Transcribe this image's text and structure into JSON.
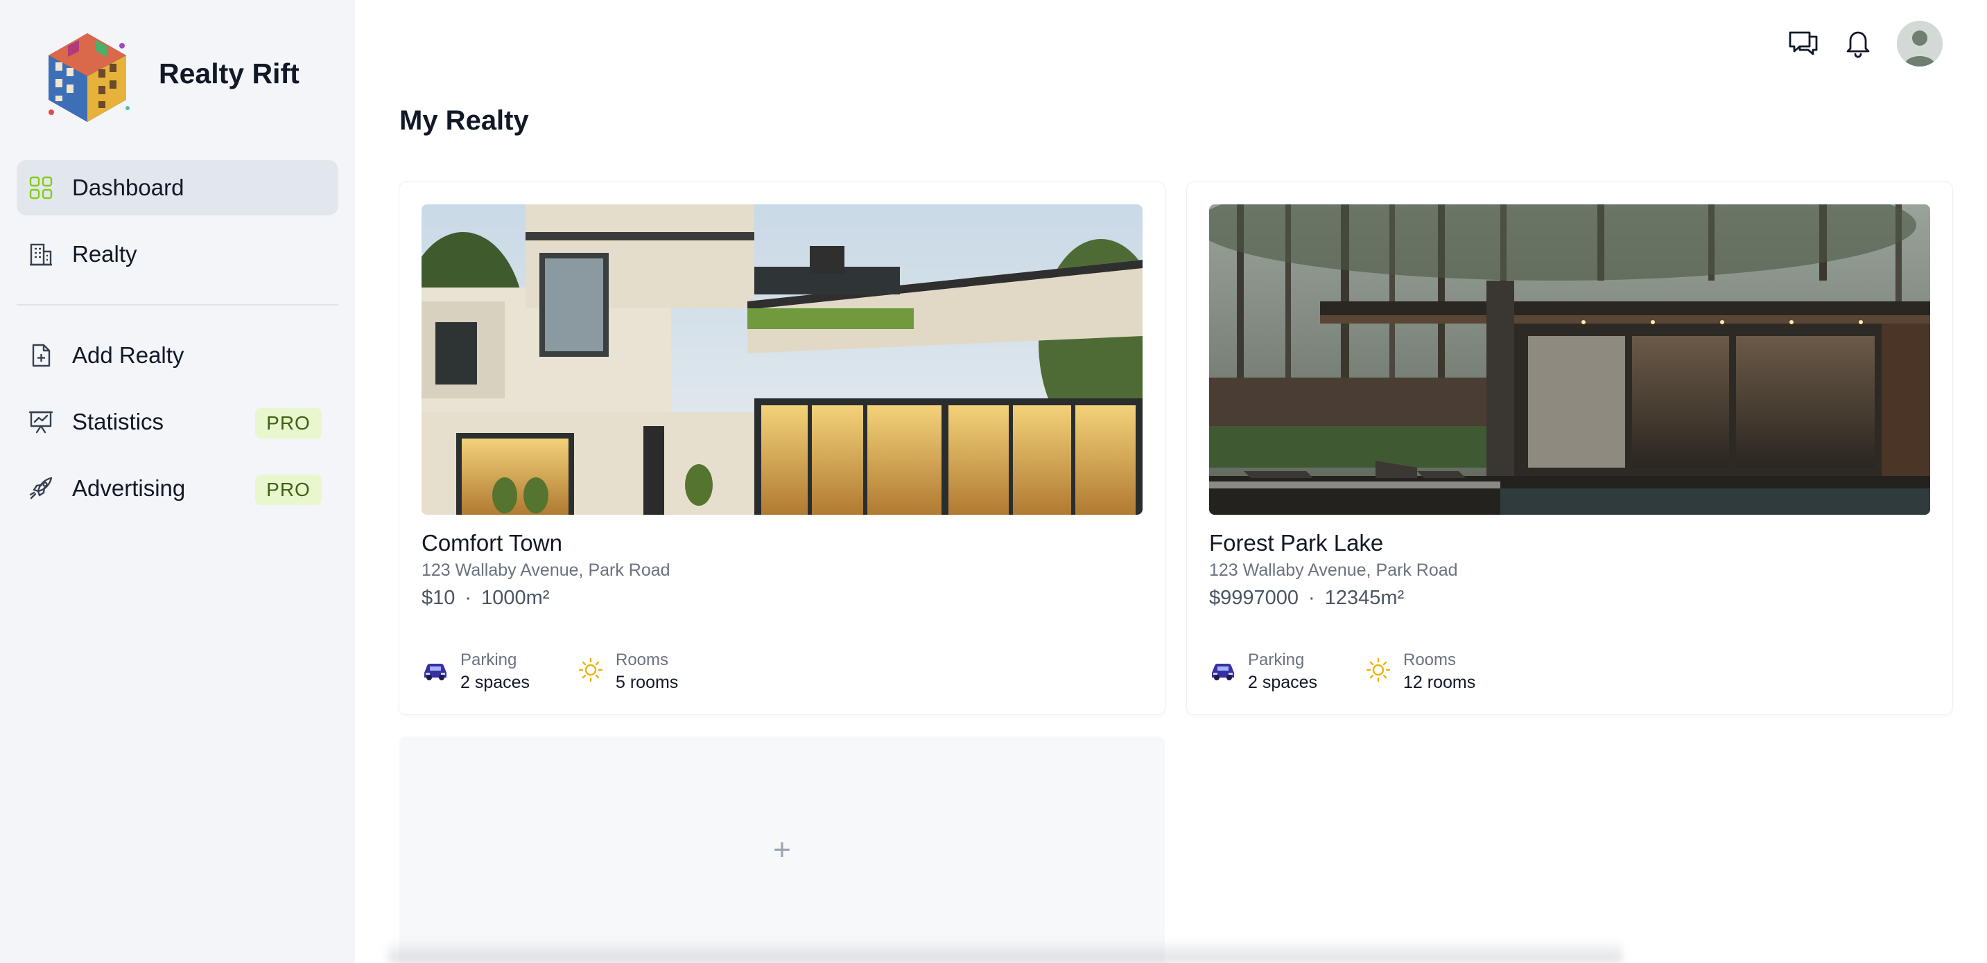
{
  "brand": {
    "name": "Realty Rift",
    "logo_icon": "building-cube-logo"
  },
  "sidebar": {
    "items": [
      {
        "label": "Dashboard",
        "icon": "grid-icon",
        "active": true
      },
      {
        "label": "Realty",
        "icon": "building-icon"
      },
      {
        "label": "Add Realty",
        "icon": "file-plus-icon"
      },
      {
        "label": "Statistics",
        "icon": "chart-board-icon",
        "badge": "PRO"
      },
      {
        "label": "Advertising",
        "icon": "rocket-icon",
        "badge": "PRO"
      }
    ]
  },
  "header": {
    "icons": [
      "chat-icon",
      "bell-icon",
      "user-avatar"
    ]
  },
  "main": {
    "title": "My Realty",
    "cards": [
      {
        "title": "Comfort Town",
        "address": "123 Wallaby Avenue, Park Road",
        "price": "$10",
        "separator": "·",
        "area": "1000m²",
        "parking_label": "Parking",
        "parking_value": "2 spaces",
        "rooms_label": "Rooms",
        "rooms_value": "5 rooms"
      },
      {
        "title": "Forest Park Lake",
        "address": "123 Wallaby Avenue, Park Road",
        "price": "$9997000",
        "separator": "·",
        "area": "12345m²",
        "parking_label": "Parking",
        "parking_value": "2 spaces",
        "rooms_label": "Rooms",
        "rooms_value": "12 rooms"
      }
    ],
    "add_card": {
      "symbol": "+"
    }
  },
  "colors": {
    "sidebar_bg": "#f3f5f8",
    "active_item_bg": "#e2e7ee",
    "pro_badge_bg": "#e9f7cf",
    "pro_badge_text": "#3f6212",
    "grid_icon": "#84cc16",
    "car_icon": "#3730a3",
    "sun_icon": "#eab308"
  }
}
